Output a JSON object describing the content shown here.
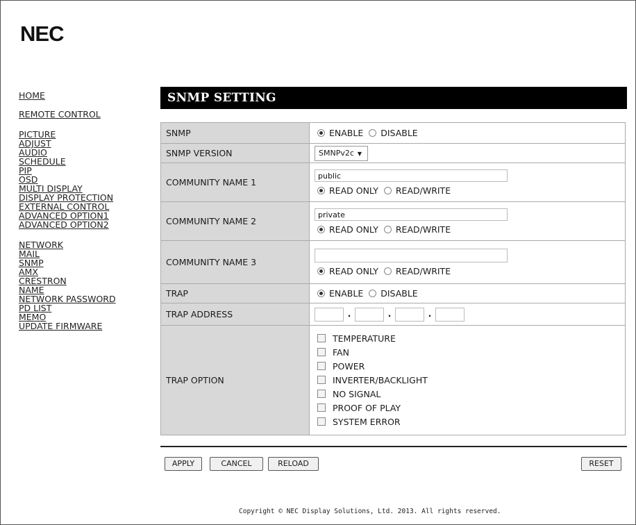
{
  "brand": "NEC",
  "nav": {
    "group1": [
      "HOME",
      "REMOTE CONTROL"
    ],
    "group2": [
      "PICTURE",
      "ADJUST",
      "AUDIO",
      "SCHEDULE",
      "PIP",
      "OSD",
      "MULTI DISPLAY",
      "DISPLAY PROTECTION",
      "EXTERNAL CONTROL",
      "ADVANCED OPTION1",
      "ADVANCED OPTION2"
    ],
    "group3": [
      "NETWORK",
      "MAIL",
      "SNMP",
      "AMX",
      "CRESTRON",
      "NAME",
      "NETWORK PASSWORD",
      "PD LIST",
      "MEMO",
      "UPDATE FIRMWARE"
    ]
  },
  "page_title": "SNMP SETTING",
  "rows": {
    "snmp": {
      "label": "SNMP",
      "opt1": "ENABLE",
      "opt2": "DISABLE",
      "selected": "ENABLE"
    },
    "version": {
      "label": "SNMP VERSION",
      "value": "SMNPv2c"
    },
    "c1": {
      "label": "COMMUNITY NAME 1",
      "value": "public",
      "opt1": "READ ONLY",
      "opt2": "READ/WRITE",
      "selected": "READ ONLY"
    },
    "c2": {
      "label": "COMMUNITY NAME 2",
      "value": "private",
      "opt1": "READ ONLY",
      "opt2": "READ/WRITE",
      "selected": "READ ONLY"
    },
    "c3": {
      "label": "COMMUNITY NAME 3",
      "value": "",
      "opt1": "READ ONLY",
      "opt2": "READ/WRITE",
      "selected": "READ ONLY"
    },
    "trap": {
      "label": "TRAP",
      "opt1": "ENABLE",
      "opt2": "DISABLE",
      "selected": "ENABLE"
    },
    "trap_address": {
      "label": "TRAP ADDRESS",
      "octets": [
        "",
        "",
        "",
        ""
      ]
    },
    "trap_option": {
      "label": "TRAP OPTION",
      "options": [
        "TEMPERATURE",
        "FAN",
        "POWER",
        "INVERTER/BACKLIGHT",
        "NO SIGNAL",
        "PROOF OF PLAY",
        "SYSTEM ERROR"
      ]
    }
  },
  "buttons": {
    "apply": "APPLY",
    "cancel": "CANCEL",
    "reload": "RELOAD",
    "reset": "RESET"
  },
  "copyright": "Copyright © NEC Display Solutions, Ltd. 2013. All rights reserved."
}
